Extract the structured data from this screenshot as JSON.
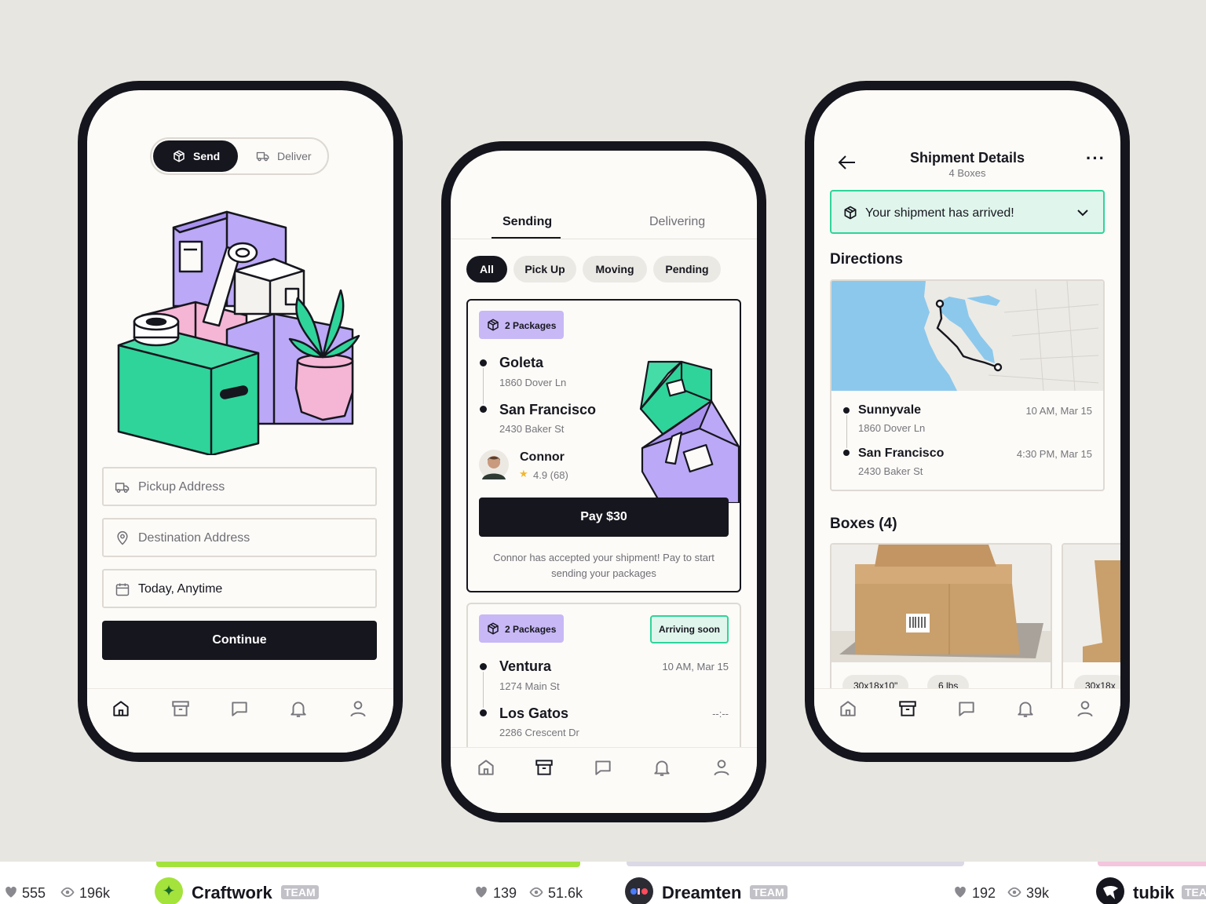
{
  "tabs": [
    "home-icon",
    "archive-icon",
    "chat-icon",
    "bell-icon",
    "user-icon"
  ],
  "phone1": {
    "seg_send": "Send",
    "seg_deliver": "Deliver",
    "pickup_placeholder": "Pickup Address",
    "destination_placeholder": "Destination Address",
    "date_value": "Today, Anytime",
    "continue_label": "Continue"
  },
  "phone2": {
    "tab_sending": "Sending",
    "tab_delivering": "Delivering",
    "chips": [
      "All",
      "Pick Up",
      "Moving",
      "Pending"
    ],
    "card1": {
      "packages": "2 Packages",
      "from_city": "Goleta",
      "from_addr": "1860 Dover Ln",
      "to_city": "San Francisco",
      "to_addr": "2430 Baker St",
      "driver": "Connor",
      "rating": "4.9 (68)",
      "pay_label": "Pay $30",
      "note": "Connor has accepted your shipment! Pay to start sending your packages"
    },
    "card2": {
      "packages": "2 Packages",
      "status": "Arriving soon",
      "from_city": "Ventura",
      "from_addr": "1274 Main St",
      "from_time": "10 AM, Mar 15",
      "to_city": "Los Gatos",
      "to_addr": "2286 Crescent Dr",
      "to_time": "--:--"
    }
  },
  "phone3": {
    "title": "Shipment Details",
    "subtitle": "4 Boxes",
    "alert": "Your shipment has arrived!",
    "directions_heading": "Directions",
    "from_city": "Sunnyvale",
    "from_addr": "1860 Dover Ln",
    "from_time": "10 AM, Mar 15",
    "to_city": "San Francisco",
    "to_addr": "2430 Baker St",
    "to_time": "4:30 PM, Mar 15",
    "boxes_heading": "Boxes (4)",
    "box_tags": [
      "30x18x10\"",
      "6 lbs",
      "30x18x"
    ]
  },
  "footer": {
    "shot1": {
      "likes": "555",
      "views": "196k"
    },
    "shot2": {
      "studio": "Craftwork",
      "team": "TEAM",
      "likes": "139",
      "views": "51.6k"
    },
    "shot3": {
      "studio": "Dreamten",
      "team": "TEAM",
      "likes": "192",
      "views": "39k"
    },
    "shot4": {
      "studio": "tubik",
      "team": "TEAM"
    }
  },
  "colors": {
    "accent_green": "#2fd49a",
    "accent_purple": "#bba8f6",
    "accent_pink": "#f5b5d4",
    "dark": "#16161e",
    "bg": "#e8e6e1"
  }
}
